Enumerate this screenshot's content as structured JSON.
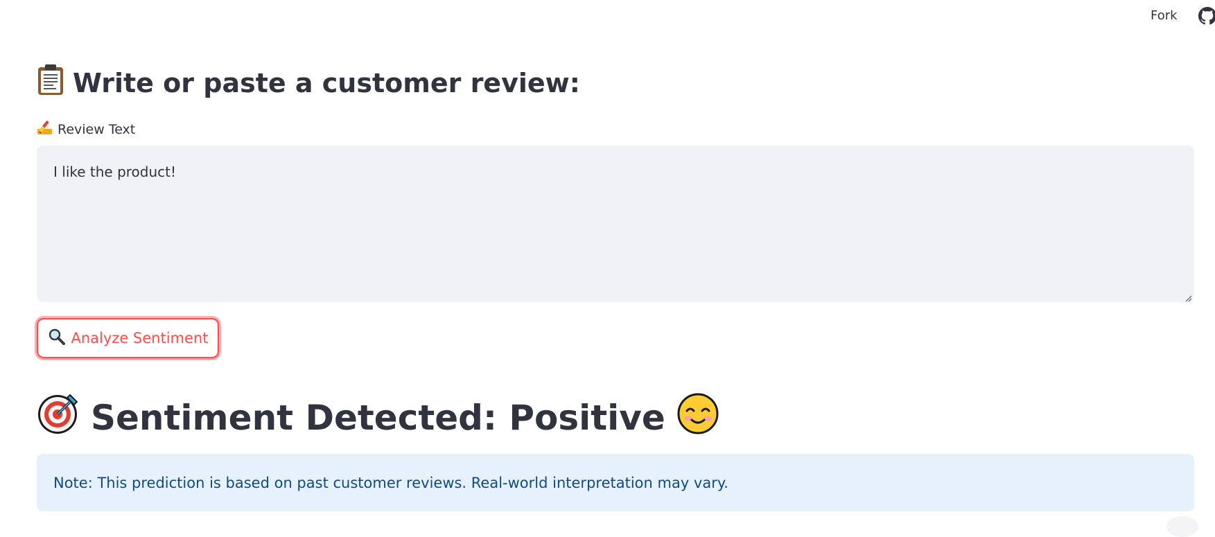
{
  "topbar": {
    "fork_label": "Fork",
    "github_icon": "github-icon"
  },
  "review_section": {
    "heading": "Write or paste a customer review:",
    "heading_icon": "clipboard-icon",
    "field_label": "Review Text",
    "field_icon": "writing-hand-icon",
    "review_value": "I like the product!",
    "input_bg": "#f0f2f6"
  },
  "analyze_button": {
    "label": "Analyze Sentiment",
    "icon": "magnifying-glass-icon",
    "accent": "#ff4b4b"
  },
  "result": {
    "heading": "Sentiment Detected: Positive",
    "target_icon": "direct-hit-icon",
    "sentiment_icon": "smiling-face-icon"
  },
  "info": {
    "text": "Note: This prediction is based on past customer reviews. Real-world interpretation may vary.",
    "bg": "#e7f1fb",
    "fg": "#0b4c84"
  }
}
